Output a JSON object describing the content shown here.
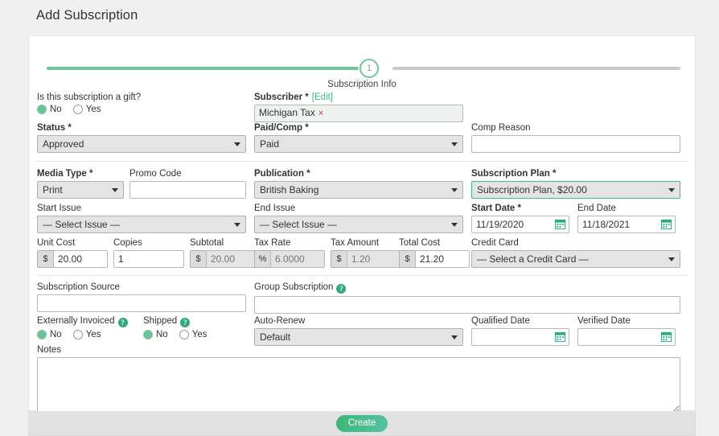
{
  "page": {
    "title": "Add Subscription"
  },
  "stepper": {
    "step_number": "1",
    "step_label": "Subscription Info"
  },
  "form": {
    "gift": {
      "label": "Is this subscription a gift?",
      "options": [
        "No",
        "Yes"
      ],
      "selected": "No"
    },
    "subscriber": {
      "label": "Subscriber *",
      "edit_link": "[Edit]",
      "edit_text": "Edit",
      "token": "Michigan Tax",
      "token_remove": "×"
    },
    "status": {
      "label": "Status *",
      "value": "Approved"
    },
    "paid_comp": {
      "label": "Paid/Comp *",
      "value": "Paid"
    },
    "comp_reason": {
      "label": "Comp Reason",
      "value": ""
    },
    "media_type": {
      "label": "Media Type *",
      "value": "Print"
    },
    "promo_code": {
      "label": "Promo Code",
      "value": ""
    },
    "publication": {
      "label": "Publication *",
      "value": "British Baking"
    },
    "subscription_plan": {
      "label": "Subscription Plan *",
      "value": "Subscription Plan, $20.00"
    },
    "start_issue": {
      "label": "Start Issue",
      "value": "— Select Issue —"
    },
    "end_issue": {
      "label": "End Issue",
      "value": "— Select Issue —"
    },
    "start_date": {
      "label": "Start Date *",
      "value": "11/19/2020"
    },
    "end_date": {
      "label": "End Date",
      "value": "11/18/2021"
    },
    "unit_cost": {
      "label": "Unit Cost",
      "prefix": "$",
      "value": "20.00"
    },
    "copies": {
      "label": "Copies",
      "value": "1"
    },
    "subtotal": {
      "label": "Subtotal",
      "prefix": "$",
      "value": "20.00"
    },
    "tax_rate": {
      "label": "Tax Rate",
      "prefix": "%",
      "value": "6.0000"
    },
    "tax_amount": {
      "label": "Tax Amount",
      "prefix": "$",
      "value": "1.20"
    },
    "total_cost": {
      "label": "Total Cost",
      "prefix": "$",
      "value": "21.20"
    },
    "credit_card": {
      "label": "Credit Card",
      "value": "— Select a Credit Card —"
    },
    "subscription_source": {
      "label": "Subscription Source",
      "value": ""
    },
    "group_subscription": {
      "label": "Group Subscription",
      "help": "?",
      "value": ""
    },
    "externally_invoiced": {
      "label": "Externally Invoiced",
      "help": "?",
      "options": [
        "No",
        "Yes"
      ],
      "selected": "No"
    },
    "shipped": {
      "label": "Shipped",
      "help": "?",
      "options": [
        "No",
        "Yes"
      ],
      "selected": "No"
    },
    "auto_renew": {
      "label": "Auto-Renew",
      "value": "Default"
    },
    "qualified_date": {
      "label": "Qualified Date",
      "value": ""
    },
    "verified_date": {
      "label": "Verified Date",
      "value": ""
    },
    "notes": {
      "label": "Notes",
      "value": ""
    }
  },
  "footer": {
    "create_label": "Create"
  },
  "colors": {
    "accent_green": "#3cba8b",
    "step_done": "#6ec799",
    "step_todo": "#c9c9c9",
    "radio_checked": "#64c796",
    "token_remove": "#cc2b2b",
    "page_bg": "#f0f0f0"
  }
}
